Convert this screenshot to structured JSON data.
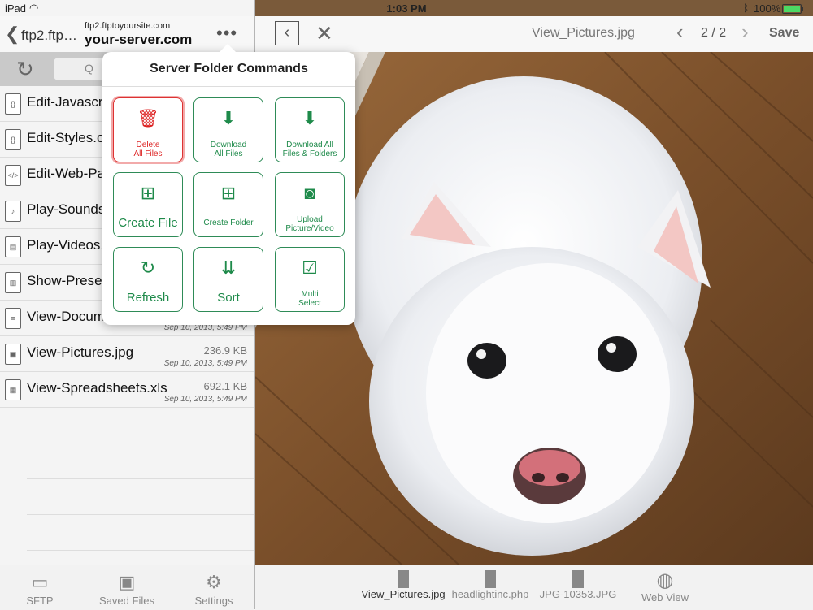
{
  "status": {
    "device": "iPad",
    "time": "1:03 PM",
    "battery": "100%"
  },
  "left": {
    "back_label": "ftp2.ftp…",
    "server_small": "ftp2.ftptoyoursite.com",
    "server_big": "your-server.com",
    "files": [
      {
        "name": "Edit-Javascript.js",
        "size": "",
        "date": ""
      },
      {
        "name": "Edit-Styles.css",
        "size": "",
        "date": ""
      },
      {
        "name": "Edit-Web-Page.html",
        "size": "",
        "date": ""
      },
      {
        "name": "Play-Sounds.mp3",
        "size": "",
        "date": ""
      },
      {
        "name": "Play-Videos.mov",
        "size": "",
        "date": ""
      },
      {
        "name": "Show-Presentation.ppt",
        "size": "",
        "date": ""
      },
      {
        "name": "View-Documents.doc",
        "size": "",
        "date": "Sep 10, 2013, 5:49 PM"
      },
      {
        "name": "View-Pictures.jpg",
        "size": "236.9 KB",
        "date": "Sep 10, 2013, 5:49 PM"
      },
      {
        "name": "View-Spreadsheets.xls",
        "size": "692.1 KB",
        "date": "Sep 10, 2013, 5:49 PM"
      }
    ],
    "tabs": [
      "SFTP",
      "Saved Files",
      "Settings"
    ]
  },
  "right": {
    "title": "View_Pictures.jpg",
    "page": "2 / 2",
    "save": "Save",
    "bottom_tabs": [
      "View_Pictures.jpg",
      "headlightinc.php",
      "JPG-10353.JPG",
      "Web View"
    ]
  },
  "popover": {
    "title": "Server Folder Commands",
    "commands": [
      {
        "line1": "Delete",
        "line2": "All Files"
      },
      {
        "line1": "Download",
        "line2": "All Files"
      },
      {
        "line1": "Download All",
        "line2": "Files & Folders"
      },
      {
        "line1": "Create File",
        "line2": ""
      },
      {
        "line1": "Create Folder",
        "line2": ""
      },
      {
        "line1": "Upload",
        "line2": "Picture/Video"
      },
      {
        "line1": "Refresh",
        "line2": ""
      },
      {
        "line1": "Sort",
        "line2": ""
      },
      {
        "line1": "Multi",
        "line2": "Select"
      }
    ]
  },
  "colors": {
    "accent_green": "#1e8a4a",
    "danger_red": "#d22222"
  }
}
